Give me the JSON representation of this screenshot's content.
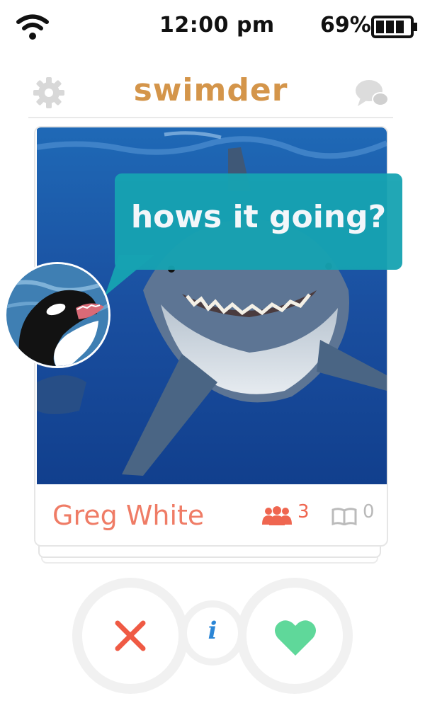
{
  "status_bar": {
    "time": "12:00 pm",
    "battery_percent": "69%",
    "battery_level": 0.69,
    "icons": [
      "wifi-icon",
      "battery-icon"
    ]
  },
  "header": {
    "logo": "swimder",
    "left_icon": "gear-icon",
    "right_icon": "chat-icon"
  },
  "profile": {
    "name": "Greg White",
    "friends_count": "3",
    "interests_count": "0",
    "photo_subject": "great-white-shark",
    "friends_icon": "friends-icon",
    "interests_icon": "book-icon"
  },
  "message": {
    "text": "hows it going?",
    "sender_avatar": "orca-avatar"
  },
  "actions": {
    "nope_icon": "x-icon",
    "info_label": "i",
    "like_icon": "heart-icon"
  },
  "colors": {
    "brand": "#d4954a",
    "name": "#ef7c66",
    "bubble": "#16a3b2",
    "nope": "#ef5a44",
    "like": "#5fd89a",
    "info": "#2b86d6"
  }
}
